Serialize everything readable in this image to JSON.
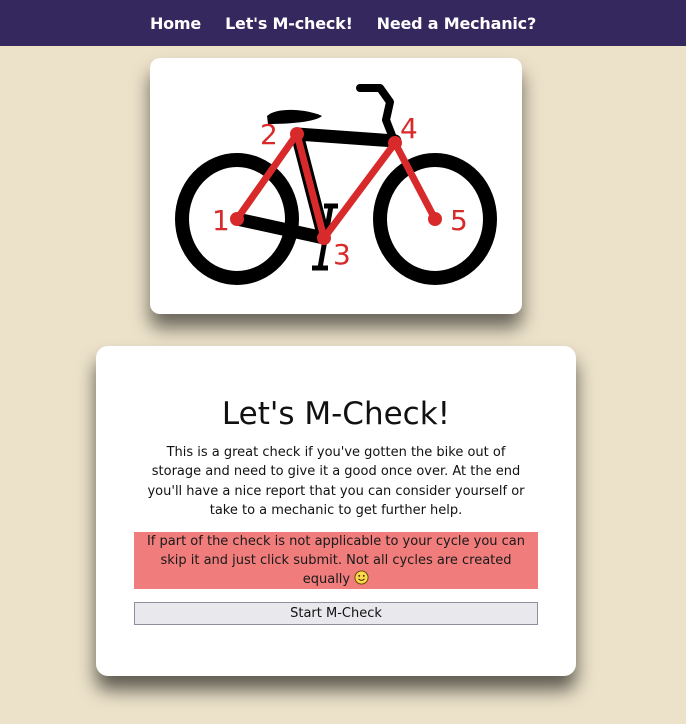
{
  "nav": {
    "items": [
      {
        "label": "Home"
      },
      {
        "label": "Let's M-check!"
      },
      {
        "label": "Need a Mechanic?"
      }
    ]
  },
  "bike": {
    "points": [
      "1",
      "2",
      "3",
      "4",
      "5"
    ],
    "frame_color": "#d82a2a",
    "body_color": "#000000"
  },
  "card": {
    "title": "Let's M-Check!",
    "description": "This is a great check if you've gotten the bike out of storage and need to give it a good once over. At the end you'll have a nice report that you can consider yourself or take to a mechanic to get further help.",
    "notice": "If part of the check is not applicable to your cycle you can skip it and just click submit. Not all cycles are created equally",
    "notice_icon": "smiley-face-icon",
    "button_label": "Start M-Check"
  },
  "colors": {
    "nav_background": "#35285e",
    "page_background": "#ece2ca",
    "notice_background": "#f07c7c"
  }
}
